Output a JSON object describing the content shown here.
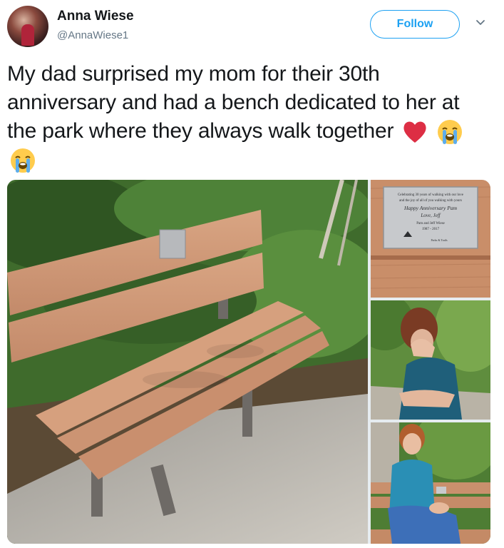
{
  "user": {
    "display_name": "Anna Wiese",
    "handle": "@AnnaWiese1"
  },
  "header": {
    "follow_label": "Follow"
  },
  "tweet": {
    "text": "My dad surprised my mom for their 30th anniversary and had a bench dedicated to her at the park where they always walk together",
    "emojis": [
      "red-heart",
      "loudly-crying-face",
      "loudly-crying-face"
    ]
  },
  "media": {
    "photos": [
      {
        "subject": "wooden park bench with plaque beside paved path"
      },
      {
        "subject": "close-up of bench plaque"
      },
      {
        "subject": "woman covering face while crying"
      },
      {
        "subject": "smiling woman seated on the bench"
      }
    ],
    "plaque": {
      "line1": "Celebrating 30 years of walking with our love",
      "line2": "and the joy of all of you walking with yours",
      "line3": "Happy Anniversary Pam",
      "line4": "Love, Jeff",
      "line5": "Pam and Jeff Wiese",
      "line6": "1987 - 2017",
      "line7": "Parks & Trails"
    }
  },
  "colors": {
    "accent": "#1da1f2",
    "text": "#14171a",
    "secondary": "#657786"
  }
}
